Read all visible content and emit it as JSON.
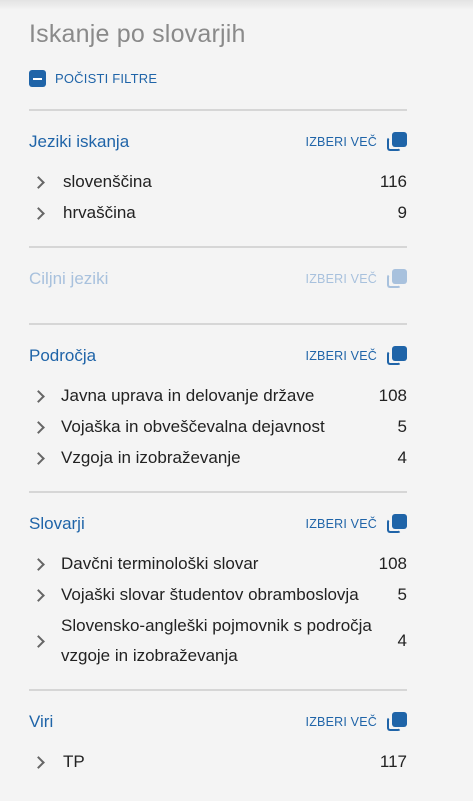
{
  "title": "Iskanje po slovarjih",
  "clear_filters": "POČISTI FILTRE",
  "sections": [
    {
      "title": "Jeziki iskanja",
      "more": "IZBERI VEČ",
      "disabled": false,
      "items": [
        {
          "label": "slovenščina",
          "count": "116"
        },
        {
          "label": "hrvaščina",
          "count": "9"
        }
      ]
    },
    {
      "title": "Ciljni jeziki",
      "more": "IZBERI VEČ",
      "disabled": true,
      "items": []
    },
    {
      "title": "Področja",
      "more": "IZBERI VEČ",
      "disabled": false,
      "items": [
        {
          "label": "Javna uprava in delovanje države",
          "count": "108"
        },
        {
          "label": "Vojaška in obveščevalna dejavnost",
          "count": "5"
        },
        {
          "label": "Vzgoja in izobraževanje",
          "count": "4"
        }
      ]
    },
    {
      "title": "Slovarji",
      "more": "IZBERI VEČ",
      "disabled": false,
      "items": [
        {
          "label": "Davčni terminološki slovar",
          "count": "108"
        },
        {
          "label": "Vojaški slovar študentov obramboslovja",
          "count": "5"
        },
        {
          "label": "Slovensko-angleški pojmovnik s področja",
          "label2": "vzgoje in izobraževanja",
          "count": "4"
        }
      ]
    },
    {
      "title": "Viri",
      "more": "IZBERI VEČ",
      "disabled": false,
      "items": [
        {
          "label": "TP",
          "count": "117"
        }
      ]
    }
  ],
  "colors": {
    "accent": "#1f64a8",
    "disabled": "#a8c1dd",
    "divider": "#d6d6d6"
  }
}
